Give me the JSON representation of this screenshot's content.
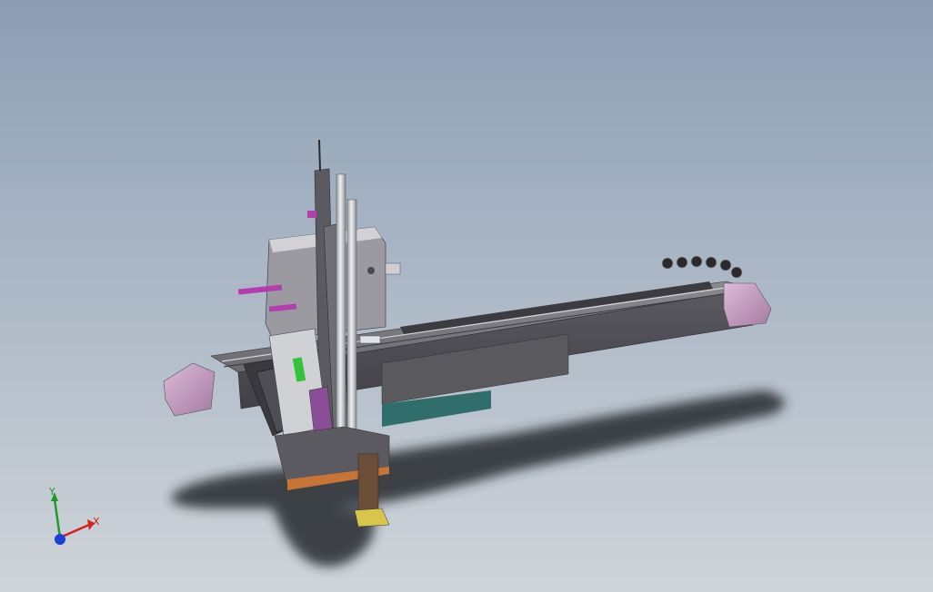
{
  "viewport": {
    "background_top": "#8c9eb4",
    "background_bottom": "#cfd4d9"
  },
  "model": {
    "description_icon": "gantry-robot-cad-model-icon",
    "colors": {
      "beam_dark": "#505056",
      "beam_mid": "#6a6a70",
      "beam_light": "#8a8a90",
      "end_cap_pink": "#c9a5c5",
      "end_cap_shadow": "#8e6e8b",
      "column_light": "#d9d9dc",
      "rod_silver": "#cfd2d6",
      "teal_plate": "#2f6e6b",
      "magenta_pin": "#b33fae",
      "green_part": "#33c33a",
      "purple_block": "#8a4e98",
      "orange_plate": "#c87436",
      "brown_gripper": "#6a4e38",
      "yellow_accent": "#d8c64c",
      "shadow": "#2b2f36"
    }
  },
  "triad": {
    "icon": "coordinate-axes-triad-icon",
    "x_label": "X",
    "y_label": "Y",
    "x_color": "#d42020",
    "y_color": "#1f9a2a",
    "z_color": "#1d3fd6"
  }
}
